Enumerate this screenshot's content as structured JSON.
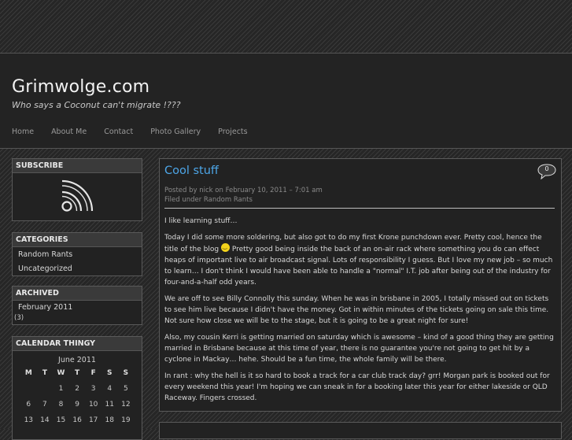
{
  "site": {
    "title": "Grimwolge.com",
    "tagline": "Who says a Coconut can't migrate !???"
  },
  "nav": [
    "Home",
    "About Me",
    "Contact",
    "Photo Gallery",
    "Projects"
  ],
  "sidebar": {
    "subscribe_title": "SUBSCRIBE",
    "categories_title": "CATEGORIES",
    "categories": [
      "Random Rants",
      "Uncategorized"
    ],
    "archived_title": "ARCHIVED",
    "archive_item": "February 2011",
    "archive_count": "(3)",
    "calendar_title": "CALENDAR THINGY",
    "calendar_month": "June 2011",
    "calendar_headers": [
      "M",
      "T",
      "W",
      "T",
      "F",
      "S",
      "S"
    ],
    "calendar_days": [
      "",
      "",
      "1",
      "2",
      "3",
      "4",
      "5",
      "6",
      "7",
      "8",
      "9",
      "10",
      "11",
      "12",
      "13",
      "14",
      "15",
      "16",
      "17",
      "18",
      "19"
    ]
  },
  "post": {
    "title": "Cool stuff",
    "comment_count": "0",
    "meta_posted": "Posted by nick on February 10, 2011 – 7:01 am",
    "meta_filed_prefix": "Filed under ",
    "meta_category": "Random Rants",
    "paragraphs": [
      "I like learning stuff…",
      "Today I did some more soldering, but also got to do my first Krone punchdown ever. Pretty cool, hence the title of the blog",
      "Pretty good being inside the back of an on-air rack where something you do can effect heaps of important live to air broadcast signal. Lots of responsibility I guess. But I love my new job – so much to learn… I don't think I would have been able to handle a \"normal\" I.T. job after being out of the industry for four-and-a-half odd years.",
      "We are off to see Billy Connolly this sunday. When he was in brisbane in 2005, I totally missed out on tickets to see him live because I didn't have the money. Got in within minutes of the tickets going on sale this time. Not sure how close we will be to the stage, but it is going to be a great night for sure!",
      "Also, my cousin Kerri is getting married on saturday which is awesome – kind of a good thing they are getting married in Brisbane because at this time of year, there is no guarantee you're not going to get hit by a cyclone in Mackay… hehe. Should be a fun time, the whole family will be there.",
      "In rant : why the hell is it so hard to book a track for a car club track day? grr! Morgan park is booked out for every weekend this year! I'm hoping we can sneak in for a booking later this year for either lakeside or QLD Raceway. Fingers crossed."
    ]
  }
}
